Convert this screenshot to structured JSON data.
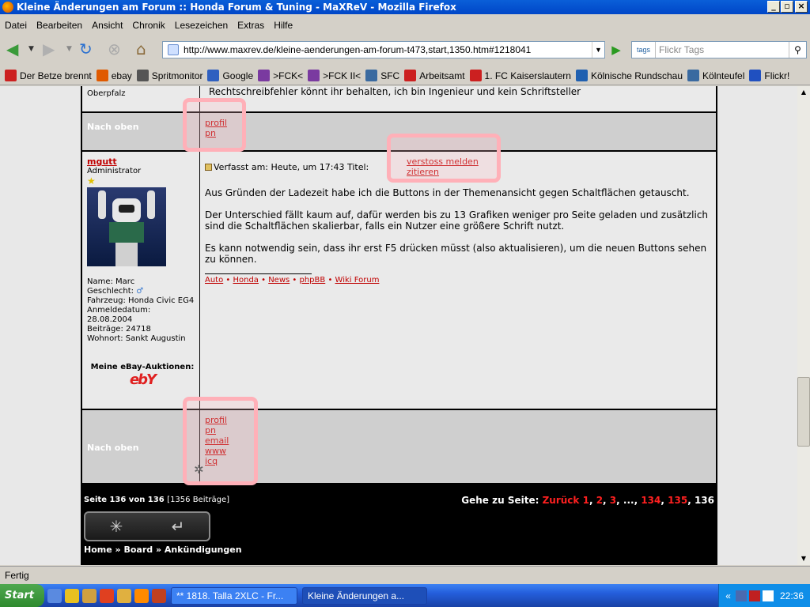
{
  "window": {
    "title": "Kleine Änderungen am Forum :: Honda Forum & Tuning - MaXReV - Mozilla Firefox"
  },
  "menu": [
    "Datei",
    "Bearbeiten",
    "Ansicht",
    "Chronik",
    "Lesezeichen",
    "Extras",
    "Hilfe"
  ],
  "nav": {
    "url": "http://www.maxrev.de/kleine-aenderungen-am-forum-t473,start,1350.htm#1218041",
    "search_placeholder": "Flickr Tags",
    "tags_label": "tags"
  },
  "bookmarks": [
    {
      "label": "Der Betze brennt",
      "color": "#cc2020"
    },
    {
      "label": "ebay",
      "color": "#e05a00"
    },
    {
      "label": "Spritmonitor",
      "color": "#555555"
    },
    {
      "label": "Google",
      "color": "#3060c0"
    },
    {
      "label": ">FCK<",
      "color": "#7a3aa0"
    },
    {
      "label": ">FCK II<",
      "color": "#7a3aa0"
    },
    {
      "label": "SFC",
      "color": "#3a6aa0"
    },
    {
      "label": "Arbeitsamt",
      "color": "#cc2020"
    },
    {
      "label": "1. FC Kaiserslautern",
      "color": "#cc2020"
    },
    {
      "label": "Kölnische Rundschau",
      "color": "#2060b0"
    },
    {
      "label": "Kölnteufel",
      "color": "#3a6aa0"
    },
    {
      "label": "Flickr!",
      "color": "#2050c0"
    }
  ],
  "prev_post": {
    "cut_left": "Oberpfalz",
    "cut_right": "Rechtschreibfehler könnt ihr behalten, ich bin Ingenieur und kein Schriftsteller",
    "nach_oben": "Nach oben",
    "links": [
      "profil",
      "pn"
    ]
  },
  "post": {
    "author": "mgutt",
    "rank": "Administrator",
    "meta": "Verfasst am: Heute, um 17:43 Titel:",
    "report": "verstoss melden",
    "quote": "zitieren",
    "paragraphs": [
      "Aus Gründen der Ladezeit habe ich die Buttons in der Themenansicht gegen Schaltflächen getauscht.",
      "Der Unterschied fällt kaum auf, dafür werden bis zu 13 Grafiken weniger pro Seite geladen und zusätzlich sind die Schaltflächen skalierbar, falls ein Nutzer eine größere Schrift nutzt.",
      "Es kann notwendig sein, dass ihr erst F5 drücken müsst (also aktualisieren), um die neuen Buttons sehen zu können."
    ],
    "sig_links": [
      "Auto",
      "Honda",
      "News",
      "phpBB",
      "Wiki Forum"
    ],
    "profile": [
      "Name: Marc",
      "Geschlecht:",
      "Fahrzeug: Honda Civic EG4",
      "Anmeldedatum:",
      "28.08.2004",
      "Beiträge: 24718",
      "Wohnort: Sankt Augustin"
    ],
    "ebay_label": "Meine eBay-Auktionen:",
    "ebay_logo": "ebY",
    "nach_oben": "Nach oben",
    "links": [
      "profil",
      "pn",
      "email",
      "www",
      "icq"
    ]
  },
  "pager": {
    "left": "Seite 136 von 136",
    "count": "[1356 Beiträge]",
    "goto": "Gehe zu Seite:",
    "back": "Zurück",
    "pages": [
      "1",
      ",",
      "2",
      ",",
      "3",
      ", ..., ",
      "134",
      ",",
      "135",
      ",",
      "136"
    ]
  },
  "breadcrumb": "Home » Board » Ankündigungen",
  "status": "Fertig",
  "taskbar": {
    "start": "Start",
    "items": [
      "** 1818. Talla 2XLC - Fr...",
      "Kleine Änderungen a..."
    ],
    "clock": "22:36"
  }
}
